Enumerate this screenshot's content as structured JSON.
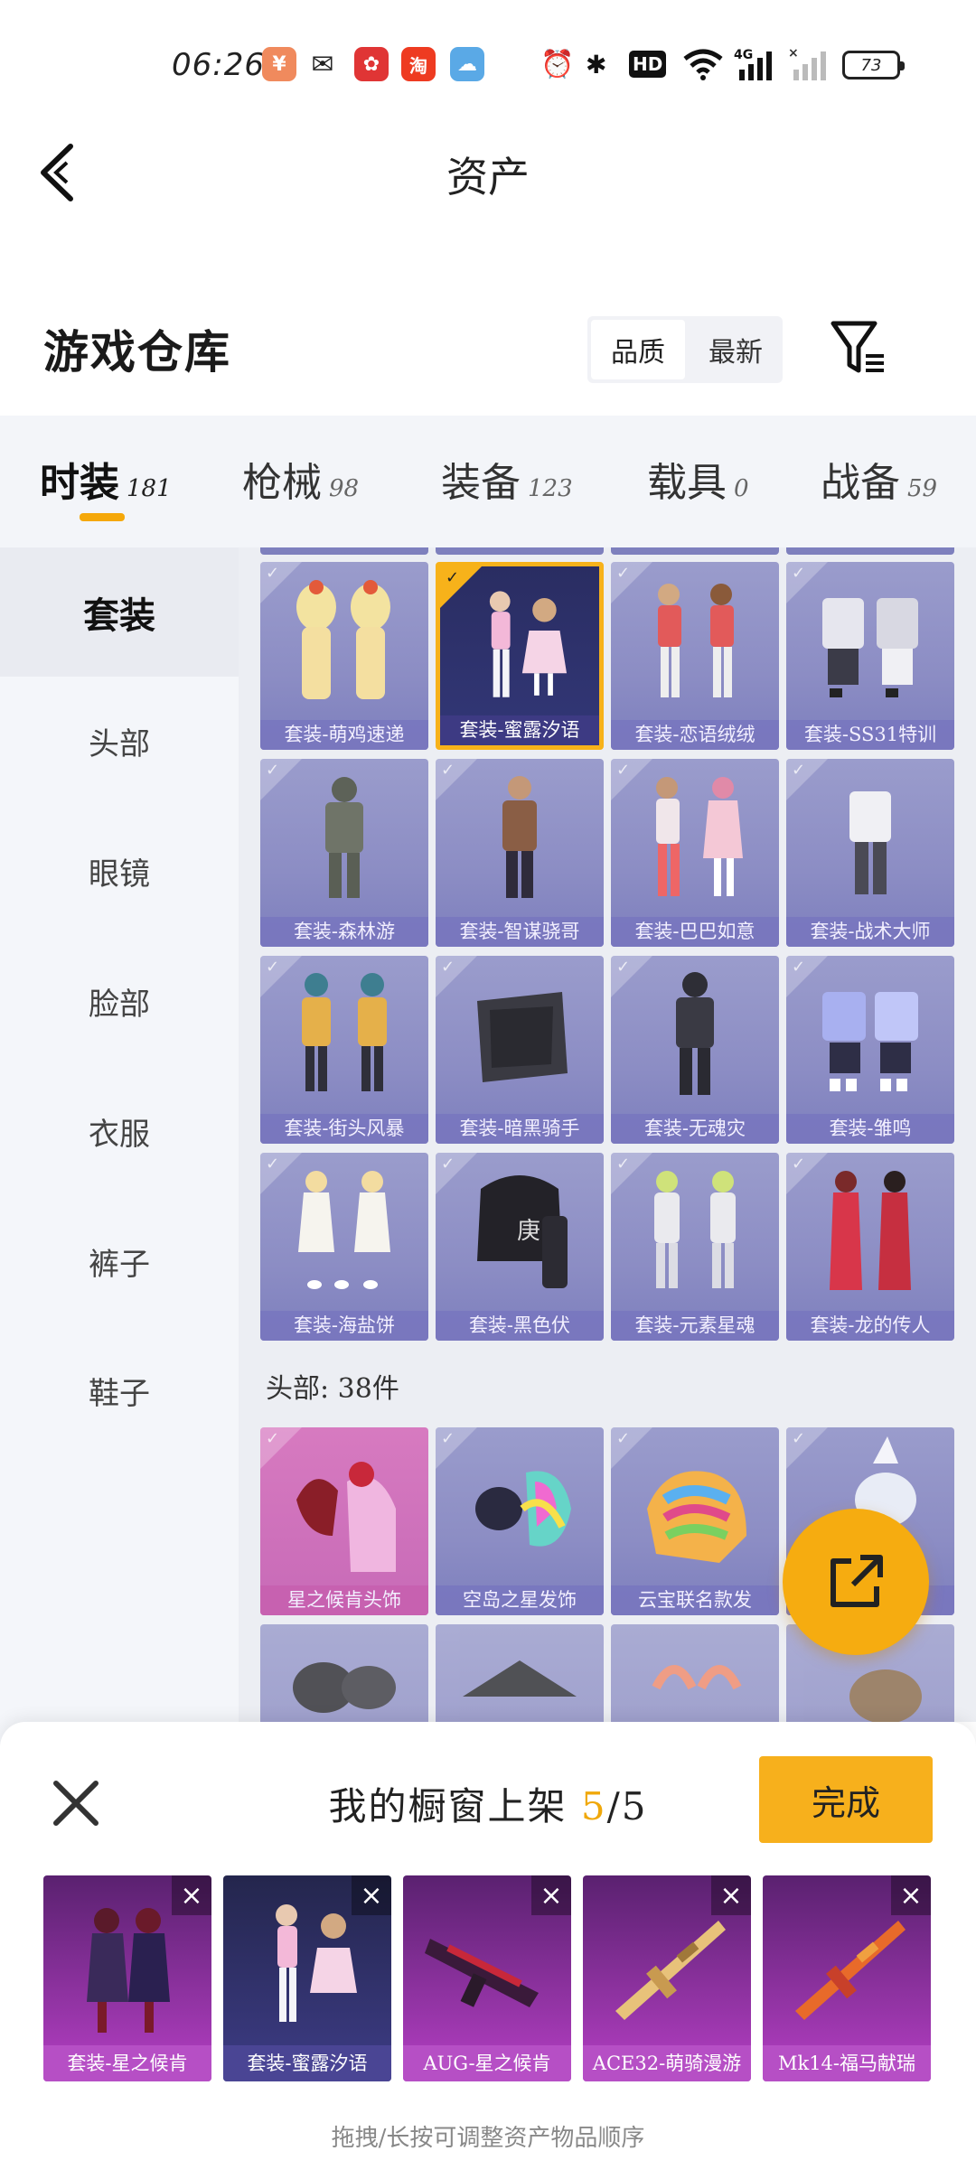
{
  "status_bar": {
    "time": "06:26",
    "battery": "73",
    "apps": [
      {
        "icon": "yuan-app-icon",
        "glyph": "¥",
        "color": "#f08a5d"
      },
      {
        "icon": "wechat-icon",
        "glyph": "✉",
        "color": "#222222"
      },
      {
        "icon": "red-app-icon",
        "glyph": "✿",
        "color": "#e03535"
      },
      {
        "icon": "taobao-icon",
        "glyph": "淘",
        "color": "#ee3b21"
      },
      {
        "icon": "weather-icon",
        "glyph": "☁",
        "color": "#5aa9e6"
      }
    ],
    "hd_label": "HD",
    "net_label": "4G"
  },
  "header": {
    "title": "资产"
  },
  "warehouse": {
    "title": "游戏仓库",
    "sort_options": [
      "品质",
      "最新"
    ]
  },
  "categories": [
    {
      "label": "时装",
      "count": "181"
    },
    {
      "label": "枪械",
      "count": "98"
    },
    {
      "label": "装备",
      "count": "123"
    },
    {
      "label": "载具",
      "count": "0"
    },
    {
      "label": "战备",
      "count": "59"
    }
  ],
  "subcategories": [
    "套装",
    "头部",
    "眼镜",
    "脸部",
    "衣服",
    "裤子",
    "鞋子"
  ],
  "outfit_items": [
    "套装-萌鸡速递",
    "套装-蜜露汐语",
    "套装-恋语绒绒",
    "套装-SS31特训",
    "套装-森林游",
    "套装-智谋骁哥",
    "套装-巴巴如意",
    "套装-战术大师",
    "套装-街头风暴",
    "套装-暗黑骑手",
    "套装-无魂灾",
    "套装-雏鸣",
    "套装-海盐饼",
    "套装-黑色伏",
    "套装-元素星魂",
    "套装-龙的传人"
  ],
  "head_section": {
    "label": "头部: 38件",
    "items": [
      "星之候肯头饰",
      "空岛之星发饰",
      "云宝联名款发",
      ""
    ]
  },
  "showcase": {
    "title": "我的橱窗上架",
    "count_current": "5",
    "count_total": "/5",
    "done_label": "完成",
    "items": [
      "套装-星之候肯",
      "套装-蜜露汐语",
      "AUG-星之候肯",
      "ACE32-萌骑漫游",
      "Mk14-福马献瑞"
    ],
    "hint": "拖拽/长按可调整资产物品顺序"
  }
}
